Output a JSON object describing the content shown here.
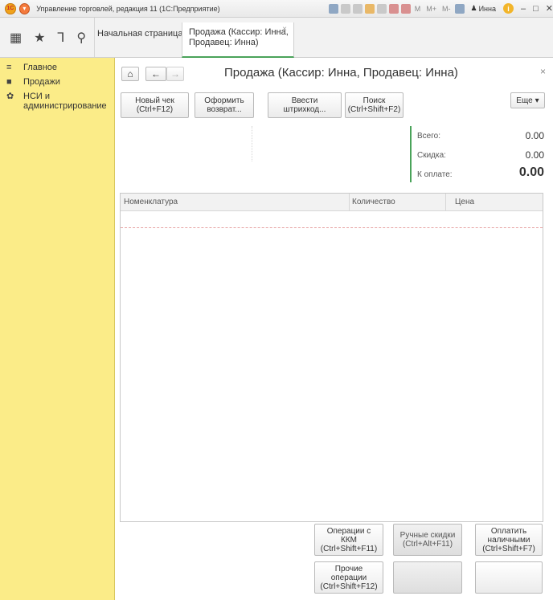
{
  "titlebar": {
    "title": "Управление торговлей, редакция 11  (1С:Предприятие)",
    "m_labels": [
      "M",
      "M+",
      "M-"
    ],
    "user": "Инна",
    "info": "i",
    "minimize": "–",
    "maximize": "□",
    "close": "✕"
  },
  "topbar": {
    "home_tab": "Начальная страница",
    "active_tab": "Продажа (Кассир: Инна, Продавец: Инна)",
    "active_tab_close": "×"
  },
  "sidebar": {
    "items": [
      {
        "icon": "menu-lines-icon",
        "glyph": "≡",
        "label": "Главное"
      },
      {
        "icon": "bag-icon",
        "glyph": "■",
        "label": "Продажи"
      },
      {
        "icon": "gear-icon",
        "glyph": "✿",
        "label": "НСИ и администрирование"
      }
    ]
  },
  "main": {
    "title": "Продажа (Кассир: Инна, Продавец: Инна)",
    "close": "×",
    "toolbar": {
      "new_check": "Новый чек\n(Ctrl+F12)",
      "return": "Оформить\nвозврат...",
      "barcode": "Ввести\nштрихкод...",
      "search": "Поиск\n(Ctrl+Shift+F2)",
      "more": "Еще",
      "more_arrow": "▾"
    },
    "summary": {
      "total_label": "Всего:",
      "total_value": "0.00",
      "discount_label": "Скидка:",
      "discount_value": "0.00",
      "to_pay_label": "К оплате:",
      "to_pay_value": "0.00"
    },
    "table": {
      "columns": [
        "Номенклатура",
        "Количество",
        "Цена"
      ]
    },
    "bottom_buttons": {
      "kkm_ops": "Операции с\nККМ\n(Ctrl+Shift+F11)",
      "manual_discounts": "Ручные скидки\n(Ctrl+Alt+F11)",
      "pay_cash": "Оплатить\nналичными\n(Ctrl+Shift+F7)",
      "other_ops": "Прочие\nоперации\n(Ctrl+Shift+F12)"
    }
  },
  "colors": {
    "sidebar_bg": "#fbec88",
    "accent_green": "#4aa35a"
  }
}
